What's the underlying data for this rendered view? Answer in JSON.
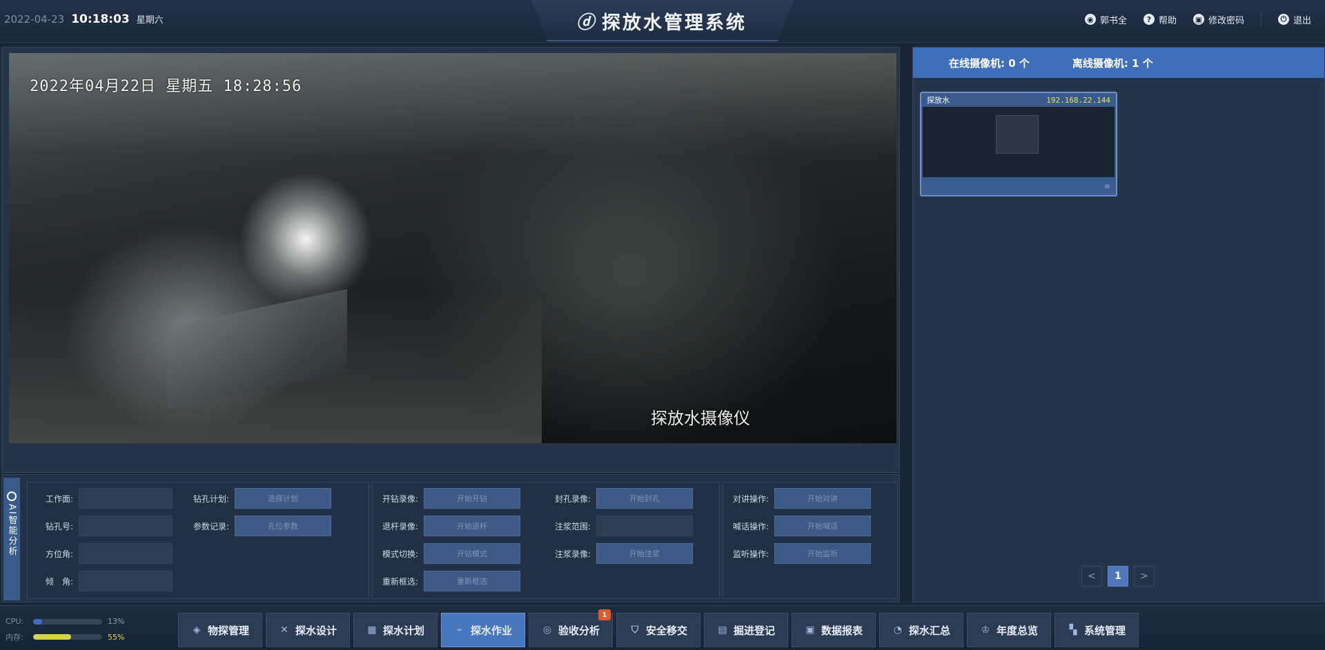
{
  "header": {
    "date": "2022-04-23",
    "time": "10:18:03",
    "weekday": "星期六",
    "title": "探放水管理系统",
    "actions": [
      {
        "label": "郭书全",
        "icon": "user-icon"
      },
      {
        "label": "帮助",
        "icon": "help-icon"
      },
      {
        "label": "修改密码",
        "icon": "lock-icon"
      },
      {
        "label": "退出",
        "icon": "power-icon"
      }
    ]
  },
  "video": {
    "osd_time": "2022年04月22日  星期五  18:28:56",
    "osd_name": "探放水摄像仪"
  },
  "ai_tab": {
    "label": "AI智能分析"
  },
  "controls": {
    "g1": {
      "work_face": "工作面:",
      "hole_no": "钻孔号:",
      "azimuth": "方位角:",
      "dip": "倾　角:",
      "drill_plan": "钻孔计划:",
      "drill_plan_btn": "选择计划",
      "param_record": "参数记录:",
      "param_record_btn": "孔位参数"
    },
    "g2": {
      "start_rec": "开钻录像:",
      "start_rec_btn": "开始开钻",
      "withdraw_rec": "退杆录像:",
      "withdraw_rec_btn": "开始退杆",
      "mode_switch": "模式切换:",
      "mode_switch_btn": "开钻模式",
      "reselect": "重新框选:",
      "reselect_btn": "重新框选",
      "seal_rec": "封孔录像:",
      "seal_rec_btn": "开始封孔",
      "grout_range": "注浆范围:",
      "grout_rec": "注浆录像:",
      "grout_rec_btn": "开始注浆"
    },
    "g3": {
      "talk_op": "对讲操作:",
      "talk_op_btn": "开始对讲",
      "broadcast_op": "喊话操作:",
      "broadcast_op_btn": "开始喊话",
      "listen_op": "监听操作:",
      "listen_op_btn": "开始监听"
    }
  },
  "camera": {
    "online": "在线摄像机: 0 个",
    "offline": "离线摄像机: 1 个",
    "card_name": "探放水",
    "card_ip": "192.168.22.144"
  },
  "pager": {
    "prev": "<",
    "page": "1",
    "next": ">"
  },
  "system": {
    "cpu_label": "CPU:",
    "cpu_value": "13%",
    "cpu_level": 0.13,
    "mem_label": "内存:",
    "mem_value": "55%",
    "mem_level": 0.55,
    "cpu_color": "#3e6fbf",
    "mem_color": "#d9d34a"
  },
  "nav": [
    {
      "label": "物探管理",
      "icon": "layers-icon"
    },
    {
      "label": "探水设计",
      "icon": "cross-tools-icon"
    },
    {
      "label": "探水计划",
      "icon": "grid-calendar-icon"
    },
    {
      "label": "探水作业",
      "icon": "drill-icon",
      "active": true
    },
    {
      "label": "验收分析",
      "icon": "magnifier-icon",
      "badge": "1"
    },
    {
      "label": "安全移交",
      "icon": "shield-icon"
    },
    {
      "label": "掘进登记",
      "icon": "document-icon"
    },
    {
      "label": "数据报表",
      "icon": "report-icon"
    },
    {
      "label": "探水汇总",
      "icon": "pie-chart-icon"
    },
    {
      "label": "年度总览",
      "icon": "trophy-icon"
    },
    {
      "label": "系统管理",
      "icon": "apps-icon"
    }
  ]
}
